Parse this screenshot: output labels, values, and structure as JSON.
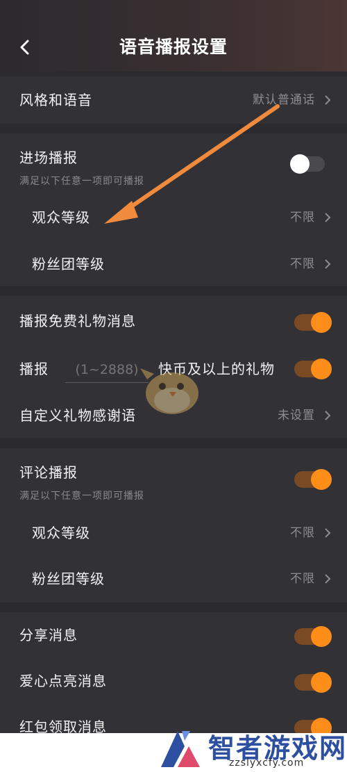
{
  "header": {
    "title": "语音播报设置"
  },
  "style_row": {
    "label": "风格和语音",
    "value": "默认普通话"
  },
  "entry": {
    "label": "进场播报",
    "sublabel": "满足以下任意一项即可播报",
    "enabled": false,
    "audience_level": {
      "label": "观众等级",
      "value": "不限"
    },
    "fan_group_level": {
      "label": "粉丝团等级",
      "value": "不限"
    }
  },
  "gifts": {
    "free_gift": {
      "label": "播报免费礼物消息",
      "enabled": true
    },
    "threshold": {
      "prefix": "播报",
      "placeholder": "(1~2888)",
      "suffix": "快币及以上的礼物",
      "enabled": true
    },
    "custom_thanks": {
      "label": "自定义礼物感谢语",
      "value": "未设置"
    }
  },
  "comments": {
    "label": "评论播报",
    "sublabel": "满足以下任意一项即可播报",
    "enabled": true,
    "audience_level": {
      "label": "观众等级",
      "value": "不限"
    },
    "fan_group_level": {
      "label": "粉丝团等级",
      "value": "不限"
    }
  },
  "messages": {
    "share": {
      "label": "分享消息",
      "enabled": true
    },
    "heart": {
      "label": "爱心点亮消息",
      "enabled": true
    },
    "red_packet": {
      "label": "红包领取消息",
      "enabled": true
    }
  },
  "watermark": {
    "name": "智者游戏网",
    "url": "zzslyxcfy.com"
  },
  "colors": {
    "accent": "#ff8d1a",
    "background": "#2b2a2e",
    "section": "#323135"
  }
}
